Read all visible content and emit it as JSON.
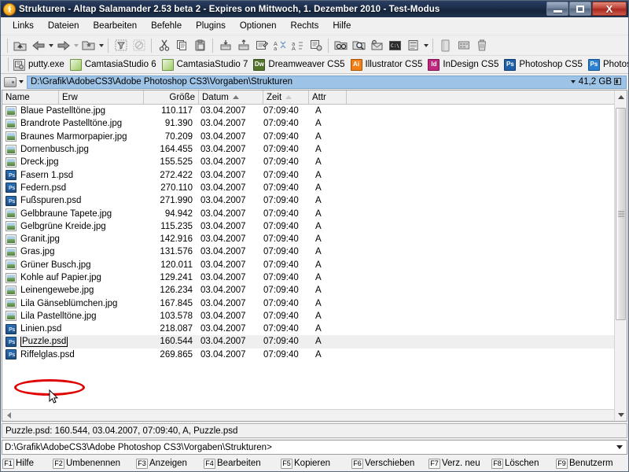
{
  "window": {
    "title": "Strukturen - Altap Salamander 2.53 beta 2 - Expires on Mittwoch, 1. Dezember 2010 - Test-Modus",
    "logo_icon": "salamander-logo-icon",
    "minimize_label": "",
    "restore_label": "",
    "close_label": "X"
  },
  "menubar": {
    "items": [
      {
        "label": "Links"
      },
      {
        "label": "Dateien"
      },
      {
        "label": "Bearbeiten"
      },
      {
        "label": "Befehle"
      },
      {
        "label": "Plugins"
      },
      {
        "label": "Optionen"
      },
      {
        "label": "Rechts"
      },
      {
        "label": "Hilfe"
      }
    ]
  },
  "toolbar": {
    "buttons": [
      {
        "icon": "folder-up-icon"
      },
      {
        "icon": "back-arrow-icon"
      },
      {
        "icon": "forward-arrow-icon"
      },
      {
        "icon": "hotpaths-icon"
      },
      {
        "icon": "filter-icon"
      },
      {
        "icon": "no-filter-icon"
      },
      {
        "icon": "cut-icon"
      },
      {
        "icon": "copy-icon"
      },
      {
        "icon": "paste-icon"
      },
      {
        "icon": "archive-pack-icon"
      },
      {
        "icon": "archive-unpack-icon"
      },
      {
        "icon": "properties-icon"
      },
      {
        "icon": "compare-dirs-icon"
      },
      {
        "icon": "change-case-icon"
      },
      {
        "icon": "change-attributes-icon"
      },
      {
        "icon": "find-files-icon"
      },
      {
        "icon": "find-in-folder-icon"
      },
      {
        "icon": "email-icon"
      },
      {
        "icon": "terminal-icon"
      },
      {
        "icon": "view-mode-icon"
      },
      {
        "icon": "drive-icon"
      },
      {
        "icon": "network-icon"
      },
      {
        "icon": "trash-icon"
      }
    ]
  },
  "appbar": {
    "items": [
      {
        "label": "putty.exe",
        "icon": "putty-icon",
        "color": "#6d6d6d",
        "text": ""
      },
      {
        "label": "CamtasiaStudio 6",
        "icon": "camtasia-icon",
        "color": "#a8cf6e",
        "text": ""
      },
      {
        "label": "CamtasiaStudio 7",
        "icon": "camtasia-icon",
        "color": "#a8cf6e",
        "text": ""
      },
      {
        "label": "Dreamweaver CS5",
        "icon": "dreamweaver-icon",
        "color": "#4f6228",
        "text": "Dw"
      },
      {
        "label": "Illustrator CS5",
        "icon": "illustrator-icon",
        "color": "#f28b1e",
        "text": "Ai"
      },
      {
        "label": "InDesign CS5",
        "icon": "indesign-icon",
        "color": "#c0267e",
        "text": "Id"
      },
      {
        "label": "Photoshop CS5",
        "icon": "photoshop-icon",
        "color": "#1f5fa8",
        "text": "Ps"
      },
      {
        "label": "Photos",
        "icon": "photoshop-icon",
        "color": "#2b7fd0",
        "text": "Ps"
      }
    ]
  },
  "pathbar": {
    "drive_icon": "drive-icon",
    "path": "D:\\Grafik\\AdobeCS3\\Adobe Photoshop CS3\\Vorgaben\\Strukturen",
    "free_space": "41,2 GB"
  },
  "columns": [
    {
      "key": "name",
      "label": "Name",
      "sort": "none"
    },
    {
      "key": "erw",
      "label": "Erw",
      "sort": "none"
    },
    {
      "key": "size",
      "label": "Größe",
      "sort": "none"
    },
    {
      "key": "date",
      "label": "Datum",
      "sort": "asc"
    },
    {
      "key": "time",
      "label": "Zeit",
      "sort": "asc-faint"
    },
    {
      "key": "attr",
      "label": "Attr",
      "sort": "none"
    }
  ],
  "files": [
    {
      "name": "Blaue Pastelltöne.jpg",
      "type": "jpg",
      "size": "110.117",
      "date": "03.04.2007",
      "time": "07:09:40",
      "attr": "A",
      "selected": false
    },
    {
      "name": "Brandrote Pastelltöne.jpg",
      "type": "jpg",
      "size": "91.390",
      "date": "03.04.2007",
      "time": "07:09:40",
      "attr": "A",
      "selected": false
    },
    {
      "name": "Braunes Marmorpapier.jpg",
      "type": "jpg",
      "size": "70.209",
      "date": "03.04.2007",
      "time": "07:09:40",
      "attr": "A",
      "selected": false
    },
    {
      "name": "Dornenbusch.jpg",
      "type": "jpg",
      "size": "164.455",
      "date": "03.04.2007",
      "time": "07:09:40",
      "attr": "A",
      "selected": false
    },
    {
      "name": "Dreck.jpg",
      "type": "jpg",
      "size": "155.525",
      "date": "03.04.2007",
      "time": "07:09:40",
      "attr": "A",
      "selected": false
    },
    {
      "name": "Fasern 1.psd",
      "type": "psd",
      "size": "272.422",
      "date": "03.04.2007",
      "time": "07:09:40",
      "attr": "A",
      "selected": false
    },
    {
      "name": "Federn.psd",
      "type": "psd",
      "size": "270.110",
      "date": "03.04.2007",
      "time": "07:09:40",
      "attr": "A",
      "selected": false
    },
    {
      "name": "Fußspuren.psd",
      "type": "psd",
      "size": "271.990",
      "date": "03.04.2007",
      "time": "07:09:40",
      "attr": "A",
      "selected": false
    },
    {
      "name": "Gelbbraune Tapete.jpg",
      "type": "jpg",
      "size": "94.942",
      "date": "03.04.2007",
      "time": "07:09:40",
      "attr": "A",
      "selected": false
    },
    {
      "name": "Gelbgrüne Kreide.jpg",
      "type": "jpg",
      "size": "115.235",
      "date": "03.04.2007",
      "time": "07:09:40",
      "attr": "A",
      "selected": false
    },
    {
      "name": "Granit.jpg",
      "type": "jpg",
      "size": "142.916",
      "date": "03.04.2007",
      "time": "07:09:40",
      "attr": "A",
      "selected": false
    },
    {
      "name": "Gras.jpg",
      "type": "jpg",
      "size": "131.576",
      "date": "03.04.2007",
      "time": "07:09:40",
      "attr": "A",
      "selected": false
    },
    {
      "name": "Grüner Busch.jpg",
      "type": "jpg",
      "size": "120.011",
      "date": "03.04.2007",
      "time": "07:09:40",
      "attr": "A",
      "selected": false
    },
    {
      "name": "Kohle auf Papier.jpg",
      "type": "jpg",
      "size": "129.241",
      "date": "03.04.2007",
      "time": "07:09:40",
      "attr": "A",
      "selected": false
    },
    {
      "name": "Leinengewebe.jpg",
      "type": "jpg",
      "size": "126.234",
      "date": "03.04.2007",
      "time": "07:09:40",
      "attr": "A",
      "selected": false
    },
    {
      "name": "Lila Gänseblümchen.jpg",
      "type": "jpg",
      "size": "167.845",
      "date": "03.04.2007",
      "time": "07:09:40",
      "attr": "A",
      "selected": false
    },
    {
      "name": "Lila Pastelltöne.jpg",
      "type": "jpg",
      "size": "103.578",
      "date": "03.04.2007",
      "time": "07:09:40",
      "attr": "A",
      "selected": false
    },
    {
      "name": "Linien.psd",
      "type": "psd",
      "size": "218.087",
      "date": "03.04.2007",
      "time": "07:09:40",
      "attr": "A",
      "selected": false
    },
    {
      "name": "Puzzle.psd",
      "type": "psd",
      "size": "160.544",
      "date": "03.04.2007",
      "time": "07:09:40",
      "attr": "A",
      "selected": true
    },
    {
      "name": "Riffelglas.psd",
      "type": "psd",
      "size": "269.865",
      "date": "03.04.2007",
      "time": "07:09:40",
      "attr": "A",
      "selected": false
    }
  ],
  "statusbar": {
    "text": "Puzzle.psd: 160.544, 03.04.2007, 07:09:40, A, Puzzle.psd"
  },
  "prompt": {
    "text": "D:\\Grafik\\AdobeCS3\\Adobe Photoshop CS3\\Vorgaben\\Strukturen>"
  },
  "fkeys": [
    {
      "key": "F1",
      "label": "Hilfe"
    },
    {
      "key": "F2",
      "label": "Umbenennen"
    },
    {
      "key": "F3",
      "label": "Anzeigen"
    },
    {
      "key": "F4",
      "label": "Bearbeiten"
    },
    {
      "key": "F5",
      "label": "Kopieren"
    },
    {
      "key": "F6",
      "label": "Verschieben"
    },
    {
      "key": "F7",
      "label": "Verz. neu"
    },
    {
      "key": "F8",
      "label": "Löschen"
    },
    {
      "key": "F9",
      "label": "Benutzerm"
    }
  ],
  "annotation": {
    "shape": "red-ellipse",
    "color": "#e00000",
    "target": "Puzzle.psd"
  }
}
